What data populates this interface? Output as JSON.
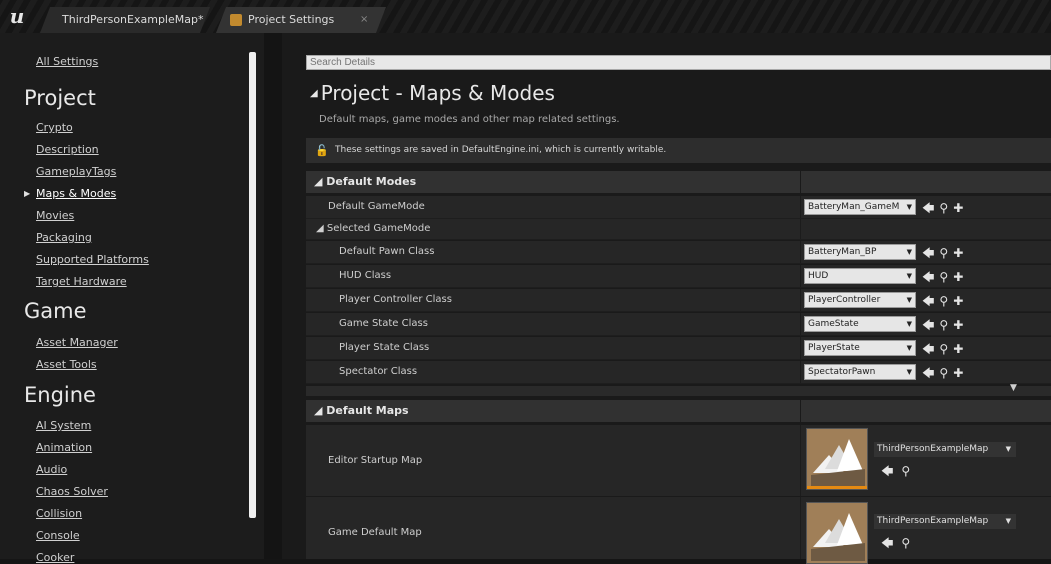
{
  "tabs": [
    {
      "label": "ThirdPersonExampleMap*"
    },
    {
      "label": "Project Settings",
      "close": "×"
    }
  ],
  "sidebar": {
    "all_settings": "All Settings",
    "sections": [
      {
        "heading": "Project",
        "items": [
          "Crypto",
          "Description",
          "GameplayTags",
          "Maps & Modes",
          "Movies",
          "Packaging",
          "Supported Platforms",
          "Target Hardware"
        ],
        "active": "Maps & Modes"
      },
      {
        "heading": "Game",
        "items": [
          "Asset Manager",
          "Asset Tools"
        ]
      },
      {
        "heading": "Engine",
        "items": [
          "AI System",
          "Animation",
          "Audio",
          "Chaos Solver",
          "Collision",
          "Console",
          "Cooker"
        ]
      }
    ]
  },
  "main": {
    "search_placeholder": "Search Details",
    "title": "Project - Maps & Modes",
    "description": "Default maps, game modes and other map related settings.",
    "notice": "These settings are saved in DefaultEngine.ini, which is currently writable.",
    "default_modes": {
      "title": "Default Modes",
      "default_gamemode_label": "Default GameMode",
      "default_gamemode_value": "BatteryMan_GameM",
      "selected_gamemode_label": "Selected GameMode",
      "classes": [
        {
          "label": "Default Pawn Class",
          "value": "BatteryMan_BP"
        },
        {
          "label": "HUD Class",
          "value": "HUD"
        },
        {
          "label": "Player Controller Class",
          "value": "PlayerController"
        },
        {
          "label": "Game State Class",
          "value": "GameState"
        },
        {
          "label": "Player State Class",
          "value": "PlayerState"
        },
        {
          "label": "Spectator Class",
          "value": "SpectatorPawn"
        }
      ]
    },
    "default_maps": {
      "title": "Default Maps",
      "maps": [
        {
          "label": "Editor Startup Map",
          "value": "ThirdPersonExampleMap"
        },
        {
          "label": "Game Default Map",
          "value": "ThirdPersonExampleMap"
        }
      ]
    }
  },
  "colors": {
    "accent": "#e58a12",
    "background": "#1a1a1a"
  }
}
